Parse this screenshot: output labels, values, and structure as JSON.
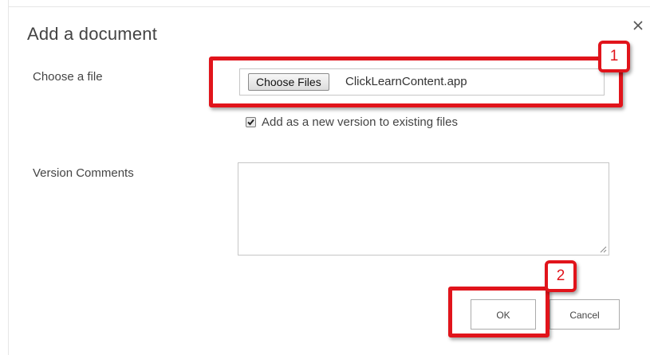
{
  "dialog": {
    "title": "Add a document",
    "close_icon": "close-icon"
  },
  "file_field": {
    "label": "Choose a file",
    "button_label": "Choose Files",
    "file_name": "ClickLearnContent.app"
  },
  "version_option": {
    "label": "Add as a new version to existing files",
    "checked": true
  },
  "comments": {
    "label": "Version Comments",
    "value": ""
  },
  "buttons": {
    "ok": "OK",
    "cancel": "Cancel"
  },
  "annotations": {
    "step1": "1",
    "step2": "2",
    "color": "#e1141b"
  }
}
